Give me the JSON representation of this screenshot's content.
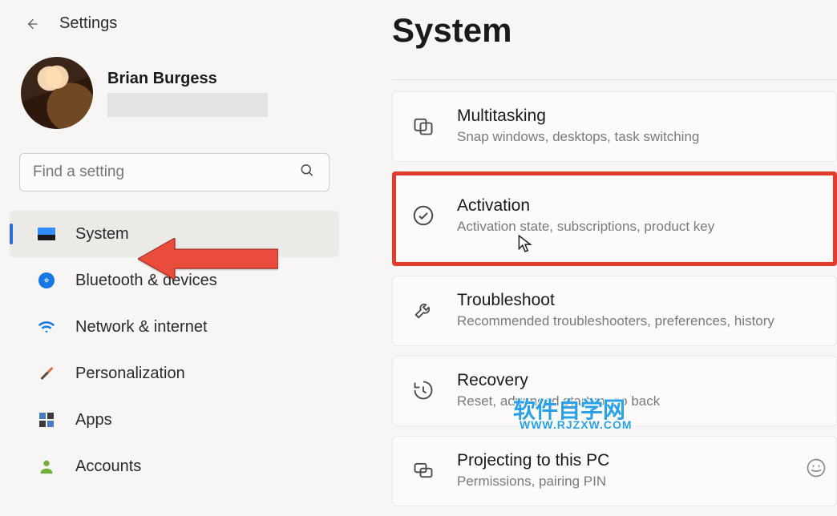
{
  "app_title": "Settings",
  "profile": {
    "name": "Brian Burgess"
  },
  "search": {
    "placeholder": "Find a setting"
  },
  "sidebar": {
    "items": [
      {
        "label": "System"
      },
      {
        "label": "Bluetooth & devices"
      },
      {
        "label": "Network & internet"
      },
      {
        "label": "Personalization"
      },
      {
        "label": "Apps"
      },
      {
        "label": "Accounts"
      }
    ]
  },
  "page": {
    "title": "System",
    "cards": [
      {
        "title": "Multitasking",
        "subtitle": "Snap windows, desktops, task switching"
      },
      {
        "title": "Activation",
        "subtitle": "Activation state, subscriptions, product key"
      },
      {
        "title": "Troubleshoot",
        "subtitle": "Recommended troubleshooters, preferences, history"
      },
      {
        "title": "Recovery",
        "subtitle": "Reset, advanced startup, go back"
      },
      {
        "title": "Projecting to this PC",
        "subtitle": "Permissions, pairing PIN"
      }
    ]
  },
  "watermark": {
    "line1": "软件自学网",
    "line2": "WWW.RJZXW.COM"
  }
}
